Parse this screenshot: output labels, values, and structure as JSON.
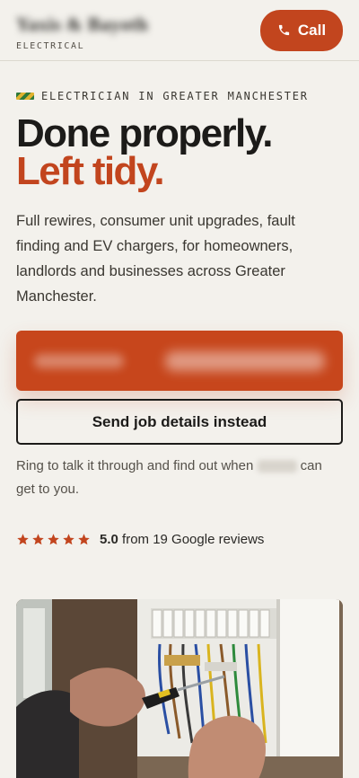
{
  "header": {
    "brand_name": "Yaxis & Bayoth",
    "brand_sub": "ELECTRICAL",
    "call_label": "Call"
  },
  "hero": {
    "eyebrow": "ELECTRICIAN IN GREATER MANCHESTER",
    "headline_line1": "Done properly.",
    "headline_line2": "Left tidy.",
    "lede": "Full rewires, consumer unit upgrades, fault finding and EV chargers, for homeowners, landlords and businesses across Greater Manchester.",
    "send_label": "Send job details instead",
    "note_before": "Ring to talk it through and find out when ",
    "note_after": " can get to you."
  },
  "rating": {
    "score": "5.0",
    "text": "from 19 Google reviews",
    "stars": 5
  },
  "colors": {
    "accent": "#c2451e",
    "background": "#f3f1ec",
    "text": "#1c1b19"
  }
}
